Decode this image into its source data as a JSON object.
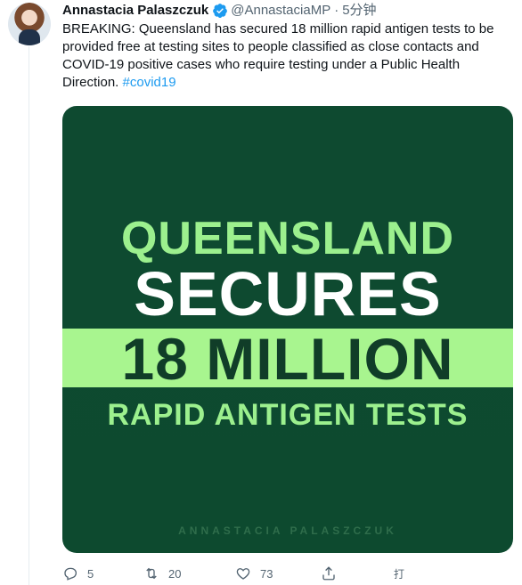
{
  "tweet": {
    "display_name": "Annastacia Palaszczuk",
    "handle": "@AnnastaciaMP",
    "separator": "·",
    "time": "5分钟",
    "text": "BREAKING: Queensland has secured 18 million rapid antigen tests to be provided free at testing sites to people classified as close contacts and COVID-19 positive cases who require testing under a Public Health Direction. ",
    "hashtag": "#covid19"
  },
  "media": {
    "line1": "QUEENSLAND",
    "line2": "SECURES",
    "line3": "18 MILLION",
    "line4": "RAPID ANTIGEN TESTS",
    "credit": "ANNASTACIA PALASZCZUK",
    "colors": {
      "background": "#0e4a30",
      "accent": "#9cf08e",
      "band": "#a8f58f"
    }
  },
  "actions": {
    "reply_count": "5",
    "retweet_count": "20",
    "like_count": "73",
    "extra_label": "打"
  },
  "icons": {
    "verified": "verified-badge-icon",
    "reply": "reply-icon",
    "retweet": "retweet-icon",
    "like": "heart-icon",
    "share": "share-icon"
  }
}
